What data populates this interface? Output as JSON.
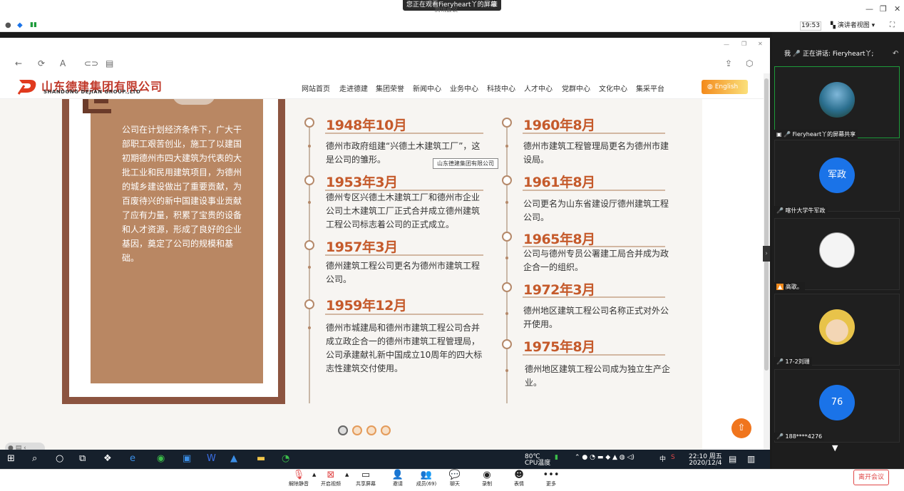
{
  "zoom": {
    "banner": "您正在观看Fieryheart丫的屏幕",
    "subtitle": "腾讯会议",
    "time": "19:53",
    "view_label": "演讲者视图",
    "speaking": "正在讲话: Fieryheart丫;",
    "me_label": "我"
  },
  "site": {
    "logo_cn": "山东德建集团有限公司",
    "logo_en": "SHANDONG DEJIAN GROUP.,LTD",
    "nav": [
      "网站首页",
      "走进德建",
      "集团荣誉",
      "新闻中心",
      "业务中心",
      "科技中心",
      "人才中心",
      "党群中心",
      "文化中心",
      "集采平台"
    ],
    "english": "English",
    "panel_text": "公司在计划经济条件下，广大干部职工艰苦创业，施工了以建国初期德州市四大建筑为代表的大批工业和民用建筑项目，为德州的城乡建设做出了重要贡献，为百废待兴的新中国建设事业贡献了应有力量，积累了宝贵的设备和人才资源，形成了良好的企业基因，奠定了公司的规模和基础。",
    "tooltip": "山东德建集团有限公司",
    "timeline_left": [
      {
        "year": "1948年10月",
        "desc": "德州市政府组建“兴德土木建筑工厂”，这是公司的雏形。"
      },
      {
        "year": "1953年3月",
        "desc": "德州专区兴德土木建筑工厂和德州市企业公司土木建筑工厂正式合并成立德州建筑工程公司标志着公司的正式成立。"
      },
      {
        "year": "1957年3月",
        "desc": "德州建筑工程公司更名为德州市建筑工程公司。"
      },
      {
        "year": "1959年12月",
        "desc": "德州市城建局和德州市建筑工程公司合并成立政企合一的德州市建筑工程管理局，公司承建献礼新中国成立10周年的四大标志性建筑交付使用。"
      }
    ],
    "timeline_right": [
      {
        "year": "1960年8月",
        "desc": "德州市建筑工程管理局更名为德州市建设局。"
      },
      {
        "year": "1961年8月",
        "desc": "公司更名为山东省建设厅德州建筑工程公司。"
      },
      {
        "year": "1965年8月",
        "desc": "公司与德州专员公署建工局合并成为政企合一的组织。"
      },
      {
        "year": "1972年3月",
        "desc": "德州地区建筑工程公司名称正式对外公开使用。"
      },
      {
        "year": "1975年8月",
        "desc": "德州地区建筑工程公司成为独立生产企业。"
      }
    ]
  },
  "taskbar": {
    "temp": "80℃",
    "cpu": "CPU温度",
    "ime": "中",
    "clock": "22:10 周五",
    "date": "2020/12/4"
  },
  "participants": [
    {
      "name": "Fieryheart丫的屏幕共享",
      "type": "photo-lake"
    },
    {
      "name": "喀什大学牛军政",
      "initials": "军政",
      "color": "#1a73e8"
    },
    {
      "name": "高歌。",
      "type": "sketch"
    },
    {
      "name": "17-2刘珊",
      "type": "cartoon"
    },
    {
      "name": "188****4276",
      "initials": "76",
      "color": "#1a73e8"
    }
  ],
  "bottom_toolbar": [
    {
      "label": "解除静音",
      "icon": "mic-muted-icon"
    },
    {
      "label": "开启视频",
      "icon": "video-off-icon"
    },
    {
      "label": "共享屏幕",
      "icon": "share-screen-icon"
    },
    {
      "label": "邀请",
      "icon": "invite-icon"
    },
    {
      "label": "成员(69)",
      "icon": "members-icon"
    },
    {
      "label": "聊天",
      "icon": "chat-icon"
    },
    {
      "label": "录制",
      "icon": "record-icon"
    },
    {
      "label": "表情",
      "icon": "emoji-icon"
    },
    {
      "label": "更多",
      "icon": "more-icon"
    }
  ],
  "leave": "离开会议",
  "colors": {
    "accent": "#c55a2b",
    "panel": "#b98763",
    "frame": "#8c5440",
    "orange": "#f0751d"
  }
}
